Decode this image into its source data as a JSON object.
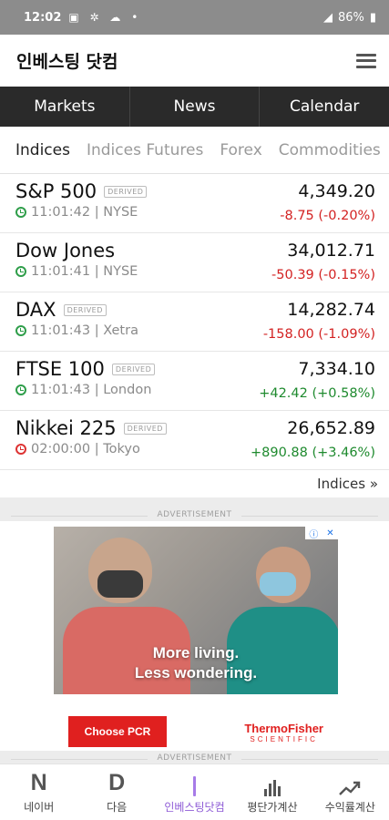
{
  "status_bar": {
    "time": "12:02",
    "battery": "86%"
  },
  "app_bar": {
    "title": "인베스팅 닷컴",
    "menu_icon": "hamburger-menu-icon"
  },
  "nav_tabs": [
    "Markets",
    "News",
    "Calendar"
  ],
  "sub_tabs": [
    {
      "label": "Indices",
      "active": true
    },
    {
      "label": "Indices Futures",
      "active": false
    },
    {
      "label": "Forex",
      "active": false
    },
    {
      "label": "Commodities",
      "active": false
    }
  ],
  "indices": [
    {
      "name": "S&P 500",
      "badge": "DERIVED",
      "time": "11:01:42",
      "exchange": "NYSE",
      "price": "4,349.20",
      "change": "-8.75 (-0.20%)",
      "direction": "down",
      "market_open": true
    },
    {
      "name": "Dow Jones",
      "badge": "",
      "time": "11:01:41",
      "exchange": "NYSE",
      "price": "34,012.71",
      "change": "-50.39 (-0.15%)",
      "direction": "down",
      "market_open": true
    },
    {
      "name": "DAX",
      "badge": "DERIVED",
      "time": "11:01:43",
      "exchange": "Xetra",
      "price": "14,282.74",
      "change": "-158.00 (-1.09%)",
      "direction": "down",
      "market_open": true
    },
    {
      "name": "FTSE 100",
      "badge": "DERIVED",
      "time": "11:01:43",
      "exchange": "London",
      "price": "7,334.10",
      "change": "+42.42 (+0.58%)",
      "direction": "up",
      "market_open": true
    },
    {
      "name": "Nikkei 225",
      "badge": "DERIVED",
      "time": "02:00:00",
      "exchange": "Tokyo",
      "price": "26,652.89",
      "change": "+890.88 (+3.46%)",
      "direction": "up",
      "market_open": false
    }
  ],
  "more_link": "Indices »",
  "ad": {
    "label": "ADVERTISEMENT",
    "headline_1": "More living.",
    "headline_2": "Less wondering.",
    "cta": "Choose PCR",
    "brand_1": "ThermoFisher",
    "brand_2": "SCIENTIFIC"
  },
  "bottom_nav": [
    {
      "label": "네이버",
      "icon_text": "N",
      "icon": "naver-icon",
      "active": false
    },
    {
      "label": "다음",
      "icon_text": "D",
      "icon": "daum-icon",
      "active": false
    },
    {
      "label": "인베스팅닷컴",
      "icon_text": "",
      "icon": "investing-icon",
      "active": true
    },
    {
      "label": "평단가계산",
      "icon_text": "",
      "icon": "bar-chart-icon",
      "active": false
    },
    {
      "label": "수익률계산",
      "icon_text": "",
      "icon": "trend-up-icon",
      "active": false
    }
  ],
  "colors": {
    "negative": "#d32222",
    "positive": "#1e8a2e",
    "accent": "#8e5bd6"
  }
}
